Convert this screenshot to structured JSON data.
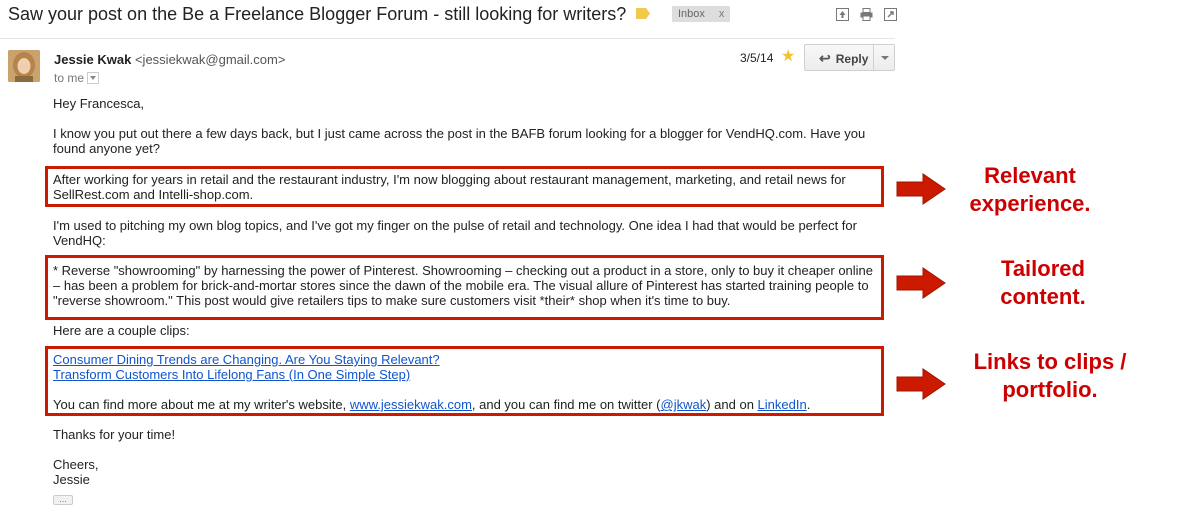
{
  "email": {
    "subject": "Saw your post on the Be a Freelance Blogger Forum - still looking for writers?",
    "label_chip": "Inbox",
    "label_chip_close": "x",
    "sender_name": "Jessie Kwak",
    "sender_email": "<jessiekwak@gmail.com>",
    "to_line": "to me",
    "date": "3/5/14",
    "reply_label": "Reply",
    "greeting": "Hey Francesca,",
    "para1": "I know you put out there a few days back, but I just came across the post in the BAFB forum looking for a blogger for VendHQ.com. Have you found anyone yet?",
    "para2": "After working for years in retail and the restaurant industry, I'm now blogging about restaurant management, marketing, and retail news for SellRest.com and Intelli-shop.com.",
    "para3": "I'm used to pitching my own blog topics, and I've got my finger on the pulse of retail and technology. One idea I had that would be perfect for VendHQ:",
    "para4": "* Reverse \"showrooming\" by harnessing the power of Pinterest. Showrooming – checking out a product in a store, only to buy it cheaper online – has been a problem for brick-and-mortar stores since the dawn of the mobile era. The visual allure of Pinterest has started training people to \"reverse showroom.\" This post would give retailers tips to make sure customers visit *their* shop when it's time to buy.",
    "para5": "Here are a couple clips:",
    "clip1": "Consumer Dining Trends are Changing. Are You Staying Relevant?",
    "clip2": "Transform Customers Into Lifelong Fans (In One Simple Step)",
    "find_pre": "You can find more about me at my writer's website, ",
    "website_link": "www.jessiekwak.com",
    "find_mid": ", and you can find me on twitter (",
    "twitter_link": "@jkwak",
    "find_mid2": ") and on ",
    "linkedin_link": "LinkedIn",
    "find_end": ".",
    "thanks": "Thanks for your time!",
    "signoff": "Cheers,",
    "signature": "Jessie",
    "more_dots": "..."
  },
  "annotations": {
    "first_line1": "Relevant",
    "first_line2": "experience.",
    "second_line1": "Tailored",
    "second_line2": "content.",
    "third_line1": "Links to clips /",
    "third_line2": "portfolio."
  },
  "colors": {
    "annotation_red": "#cc1a00",
    "link_blue": "#1155cc",
    "star_yellow": "#f1c232",
    "label_yellow": "#f2c94c"
  },
  "icons": [
    "label-tag-icon",
    "archive-icon",
    "print-icon",
    "new-window-icon",
    "star-icon",
    "reply-arrow-icon",
    "chevron-down-icon",
    "right-arrow-icon"
  ]
}
